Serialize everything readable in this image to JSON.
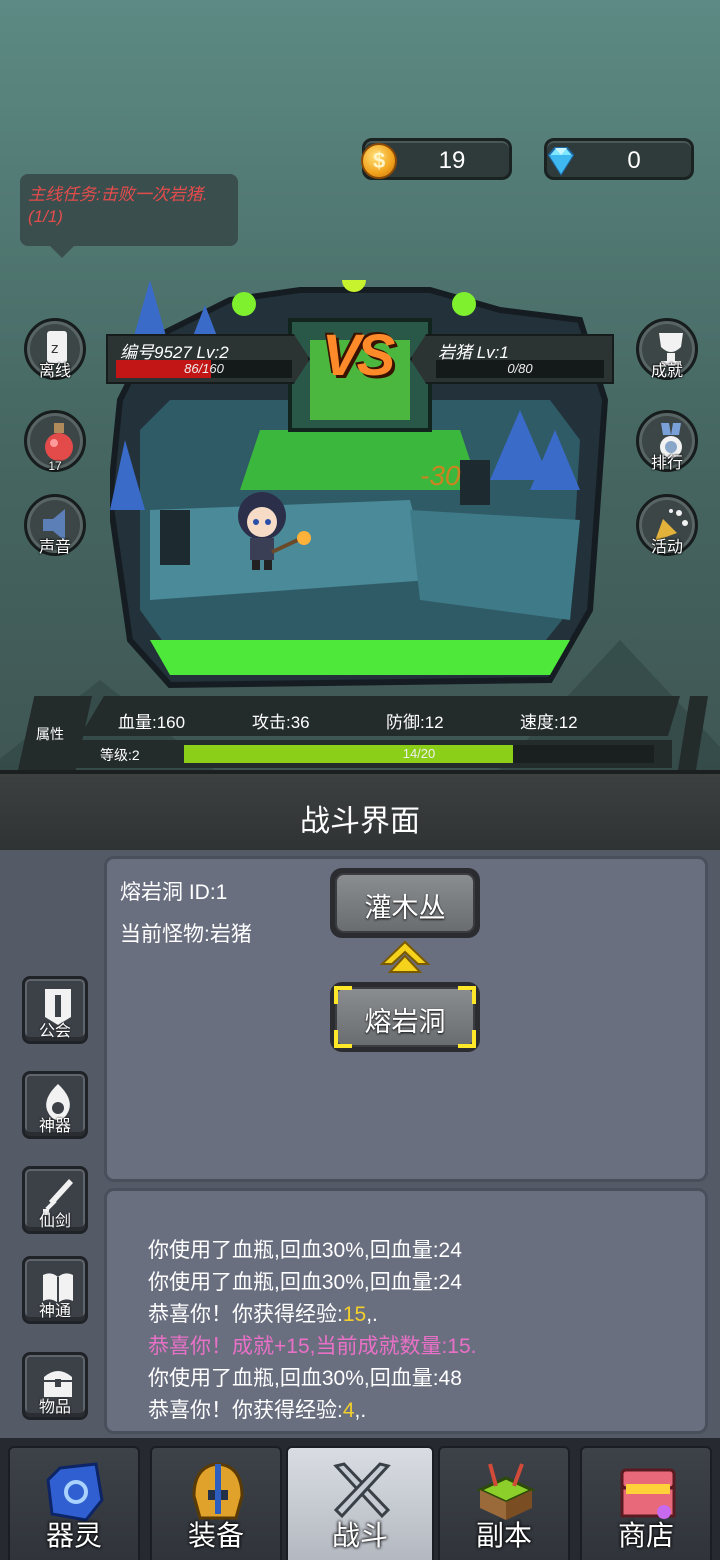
{
  "currency": {
    "gold": "19",
    "diamond": "0"
  },
  "quest": {
    "text": "主线任务:击败一次岩猪.(1/1)"
  },
  "battle": {
    "player": {
      "name": "编号9527 Lv:2",
      "hp_text": "86/160",
      "hp_fraction": 0.54
    },
    "enemy": {
      "name": "岩猪 Lv:1",
      "hp_text": "0/80",
      "hp_fraction": 0.0
    },
    "vs": "VS",
    "damage": "-30"
  },
  "left_buttons": {
    "offline": "离线",
    "potion_count": "17",
    "sound": "声音"
  },
  "right_buttons": {
    "achievement": "成就",
    "ranking": "排行",
    "activity": "活动"
  },
  "attributes": {
    "label": "属性",
    "hp": "血量:160",
    "attack": "攻击:36",
    "defense": "防御:12",
    "speed": "速度:12",
    "level": "等级:2",
    "exp_text": "14/20",
    "exp_fraction": 0.7
  },
  "panel_title": "战斗界面",
  "map": {
    "current_map": "熔岩洞 ID:1",
    "current_monster": "当前怪物:岩猪",
    "upper_area": "灌木丛",
    "selected_area": "熔岩洞"
  },
  "side_menu": [
    "公会",
    "神器",
    "仙剑",
    "神通",
    "物品"
  ],
  "log": [
    {
      "text": "你使用了血瓶,回血30%,回血量:24"
    },
    {
      "text": "你使用了血瓶,回血30%,回血量:24"
    },
    {
      "prefix": "恭喜你！你获得经验:",
      "value": "15",
      "suffix": ",."
    },
    {
      "text": "恭喜你！成就+15,当前成就数量:15."
    },
    {
      "text": "你使用了血瓶,回血30%,回血量:48"
    },
    {
      "prefix": "恭喜你！你获得经验:",
      "value": "4",
      "suffix": ",."
    }
  ],
  "nav": {
    "tabs": [
      "器灵",
      "装备",
      "战斗",
      "副本",
      "商店"
    ],
    "active": "战斗"
  }
}
